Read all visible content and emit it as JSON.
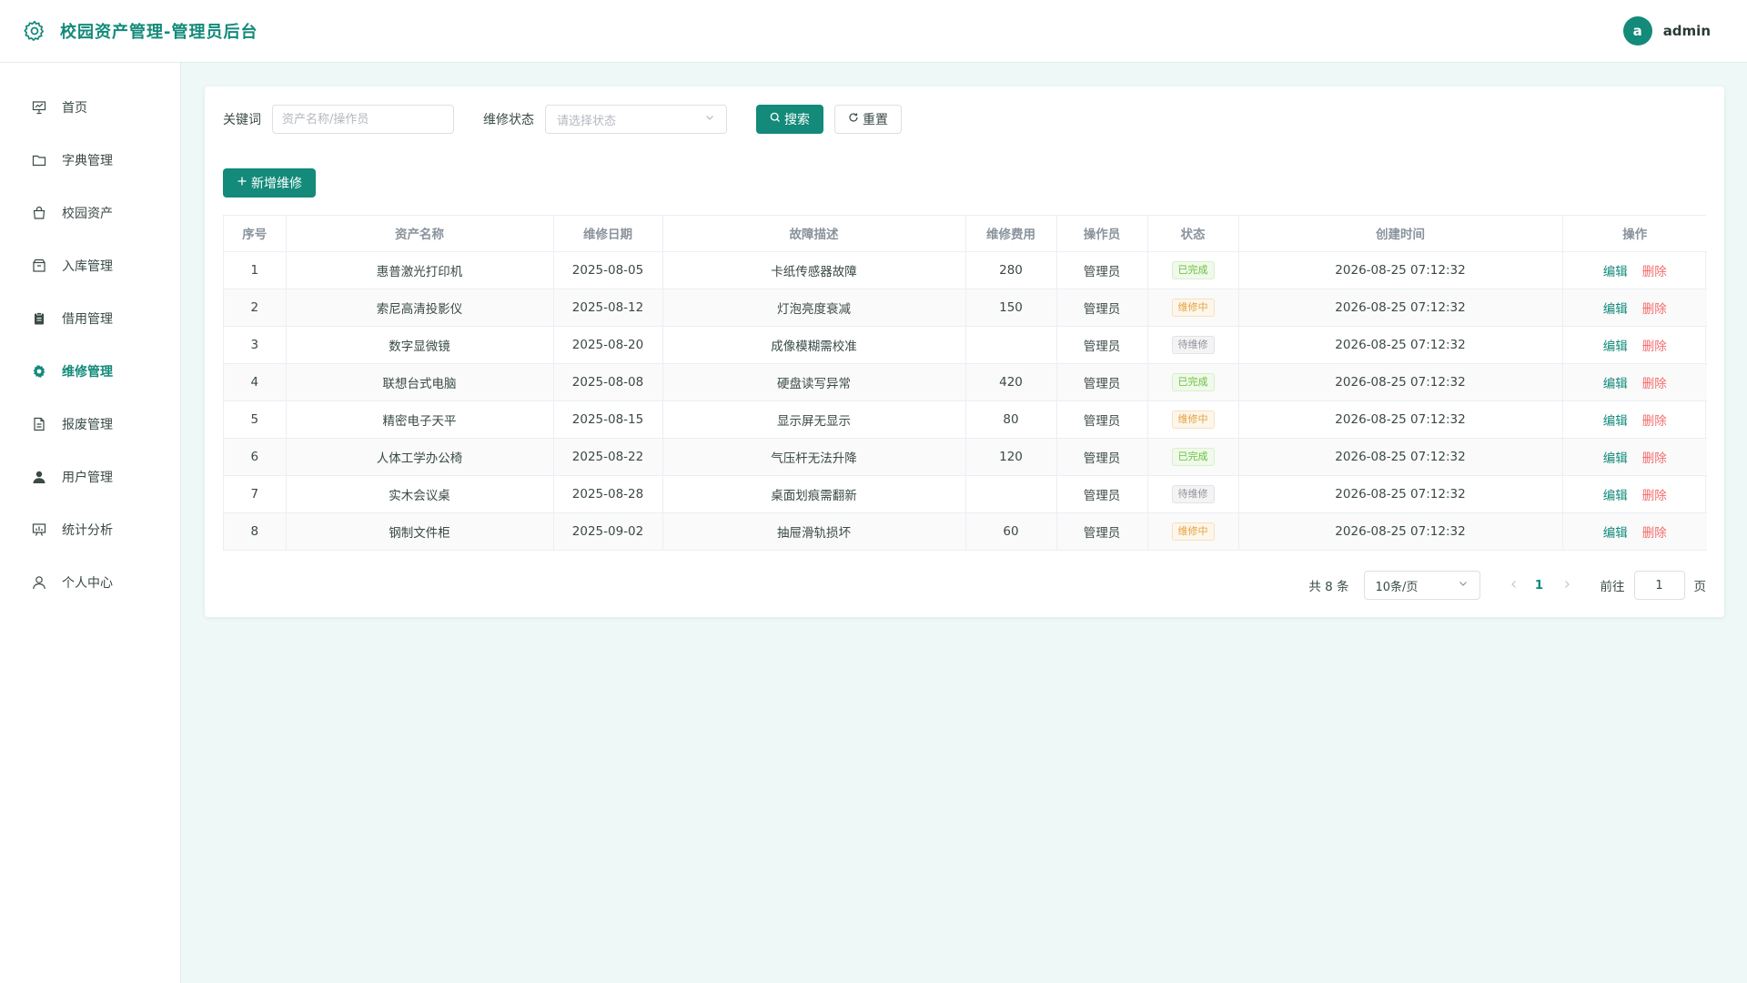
{
  "header": {
    "title": "校园资产管理-管理员后台",
    "avatar_letter": "a",
    "username": "admin",
    "accent": "#138a7a"
  },
  "sidebar": {
    "items": [
      {
        "label": "首页",
        "icon": "presentation-icon",
        "active": false
      },
      {
        "label": "字典管理",
        "icon": "folder-icon",
        "active": false
      },
      {
        "label": "校园资产",
        "icon": "bag-icon",
        "active": false
      },
      {
        "label": "入库管理",
        "icon": "box-icon",
        "active": false
      },
      {
        "label": "借用管理",
        "icon": "clipboard-icon",
        "active": false
      },
      {
        "label": "维修管理",
        "icon": "gear-icon",
        "active": true
      },
      {
        "label": "报废管理",
        "icon": "document-icon",
        "active": false
      },
      {
        "label": "用户管理",
        "icon": "user-filled-icon",
        "active": false
      },
      {
        "label": "统计分析",
        "icon": "chart-board-icon",
        "active": false
      },
      {
        "label": "个人中心",
        "icon": "user-outline-icon",
        "active": false
      }
    ]
  },
  "filter": {
    "keyword_label": "关键词",
    "keyword_value": "",
    "keyword_placeholder": "资产名称/操作员",
    "status_label": "维修状态",
    "status_placeholder": "请选择状态",
    "search_label": "搜索",
    "reset_label": "重置"
  },
  "toolbar": {
    "add_label": "新增维修"
  },
  "table": {
    "columns": [
      "序号",
      "资产名称",
      "维修日期",
      "故障描述",
      "维修费用",
      "操作员",
      "状态",
      "创建时间",
      "操作"
    ],
    "rows": [
      {
        "no": "1",
        "name": "惠普激光打印机",
        "date": "2025-08-05",
        "fault": "卡纸传感器故障",
        "cost": "280",
        "operator": "管理员",
        "status": "已完成",
        "status_type": "done",
        "created": "2026-08-25 07:12:32"
      },
      {
        "no": "2",
        "name": "索尼高清投影仪",
        "date": "2025-08-12",
        "fault": "灯泡亮度衰减",
        "cost": "150",
        "operator": "管理员",
        "status": "维修中",
        "status_type": "doing",
        "created": "2026-08-25 07:12:32"
      },
      {
        "no": "3",
        "name": "数字显微镜",
        "date": "2025-08-20",
        "fault": "成像模糊需校准",
        "cost": "",
        "operator": "管理员",
        "status": "待维修",
        "status_type": "wait",
        "created": "2026-08-25 07:12:32"
      },
      {
        "no": "4",
        "name": "联想台式电脑",
        "date": "2025-08-08",
        "fault": "硬盘读写异常",
        "cost": "420",
        "operator": "管理员",
        "status": "已完成",
        "status_type": "done",
        "created": "2026-08-25 07:12:32"
      },
      {
        "no": "5",
        "name": "精密电子天平",
        "date": "2025-08-15",
        "fault": "显示屏无显示",
        "cost": "80",
        "operator": "管理员",
        "status": "维修中",
        "status_type": "doing",
        "created": "2026-08-25 07:12:32"
      },
      {
        "no": "6",
        "name": "人体工学办公椅",
        "date": "2025-08-22",
        "fault": "气压杆无法升降",
        "cost": "120",
        "operator": "管理员",
        "status": "已完成",
        "status_type": "done",
        "created": "2026-08-25 07:12:32"
      },
      {
        "no": "7",
        "name": "实木会议桌",
        "date": "2025-08-28",
        "fault": "桌面划痕需翻新",
        "cost": "",
        "operator": "管理员",
        "status": "待维修",
        "status_type": "wait",
        "created": "2026-08-25 07:12:32"
      },
      {
        "no": "8",
        "name": "钢制文件柜",
        "date": "2025-09-02",
        "fault": "抽屉滑轨损坏",
        "cost": "60",
        "operator": "管理员",
        "status": "维修中",
        "status_type": "doing",
        "created": "2026-08-25 07:12:32"
      }
    ],
    "edit_label": "编辑",
    "delete_label": "删除"
  },
  "pagination": {
    "total_text": "共 8 条",
    "page_size": "10条/页",
    "current_page": "1",
    "goto_label": "前往",
    "goto_value": "1",
    "page_suffix": "页"
  }
}
